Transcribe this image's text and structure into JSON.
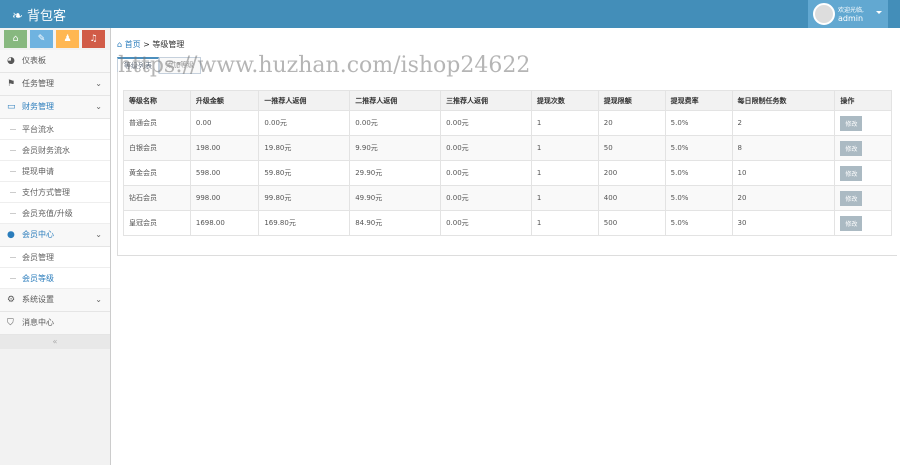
{
  "header": {
    "logo": "背包客",
    "welcome": "欢迎光临,",
    "username": "admin"
  },
  "shortcuts": [
    {
      "icon": "home-icon",
      "color": "#87b87f",
      "glyph": "⌂"
    },
    {
      "icon": "pencil-icon",
      "color": "#6fb3e0",
      "glyph": "✎"
    },
    {
      "icon": "users-icon",
      "color": "#ffb752",
      "glyph": "♟"
    },
    {
      "icon": "bell-icon",
      "color": "#d15b47",
      "glyph": "♫"
    }
  ],
  "menu": {
    "dashboard": "仪表板",
    "task": "任务管理",
    "finance": "财务管理",
    "finance_sub": [
      "平台流水",
      "会员财务流水",
      "提现申请",
      "支付方式管理",
      "会员充值/升级"
    ],
    "member": "会员中心",
    "member_sub": [
      "会员管理",
      "会员等级"
    ],
    "system": "系统设置",
    "message": "消息中心"
  },
  "breadcrumb": {
    "home": "首页",
    "sep": ">",
    "current": "等级管理"
  },
  "tabs": [
    "等级列表",
    "添加等级"
  ],
  "table": {
    "headers": [
      "等级名称",
      "升级金额",
      "一推荐人返佣",
      "二推荐人返佣",
      "三推荐人返佣",
      "提现次数",
      "提现限额",
      "提现费率",
      "每日限制任务数",
      "操作"
    ],
    "rows": [
      [
        "普通会员",
        "0.00",
        "0.00元",
        "0.00元",
        "0.00元",
        "1",
        "20",
        "5.0%",
        "2"
      ],
      [
        "白银会员",
        "198.00",
        "19.80元",
        "9.90元",
        "0.00元",
        "1",
        "50",
        "5.0%",
        "8"
      ],
      [
        "黄金会员",
        "598.00",
        "59.80元",
        "29.90元",
        "0.00元",
        "1",
        "200",
        "5.0%",
        "10"
      ],
      [
        "钻石会员",
        "998.00",
        "99.80元",
        "49.90元",
        "0.00元",
        "1",
        "400",
        "5.0%",
        "20"
      ],
      [
        "皇冠会员",
        "1698.00",
        "169.80元",
        "84.90元",
        "0.00元",
        "1",
        "500",
        "5.0%",
        "30"
      ]
    ],
    "action": "修改"
  },
  "watermark": "https://www.huzhan.com/ishop24622"
}
